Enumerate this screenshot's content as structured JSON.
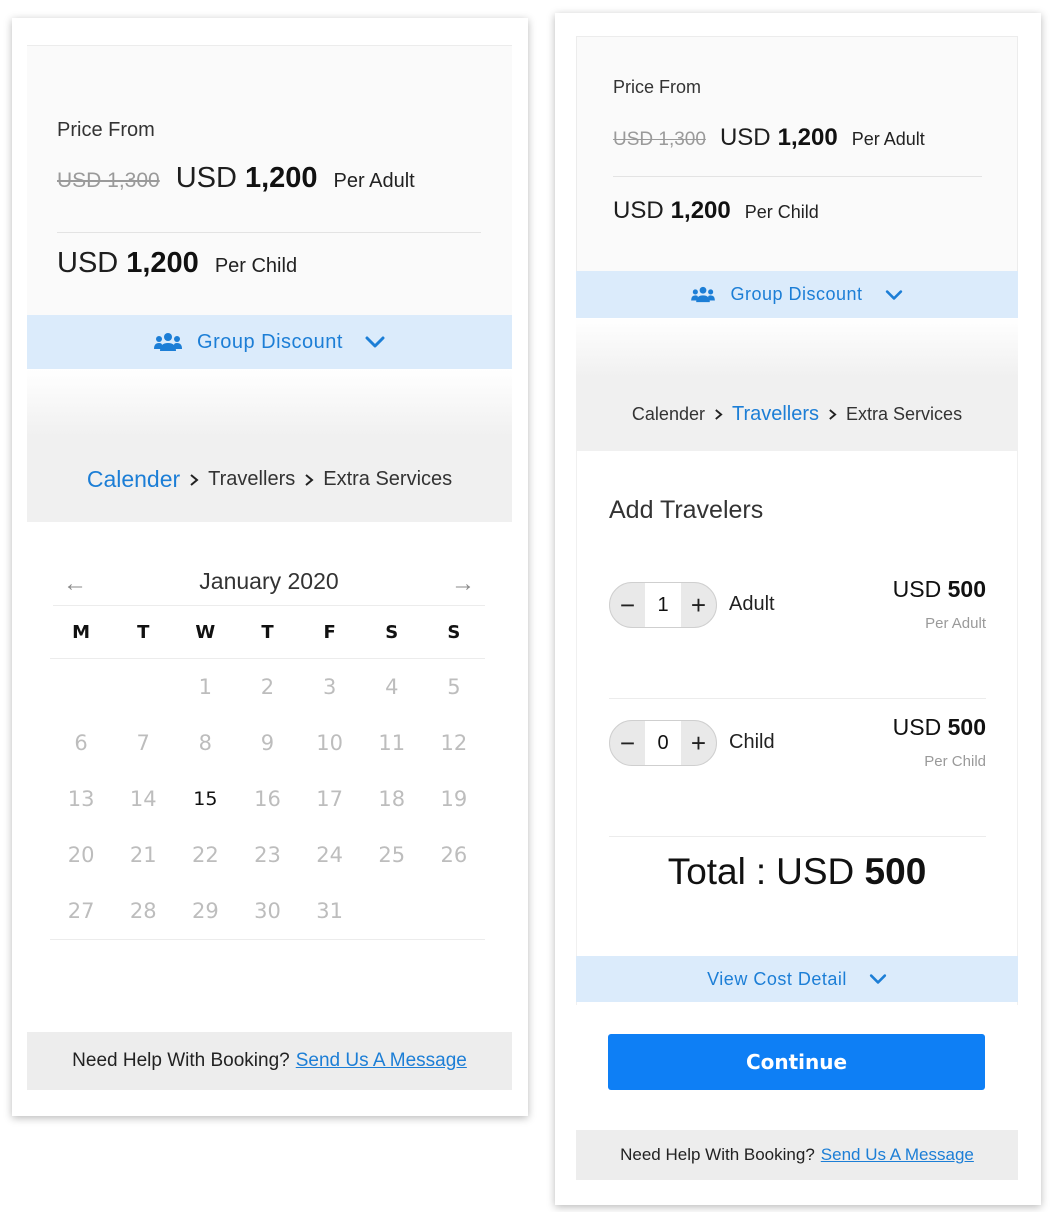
{
  "colors": {
    "accent": "#1c7ed6",
    "primary_button": "#0e7ff5",
    "discount_bg": "#dbebfb",
    "muted": "#9a9a9a"
  },
  "screen1": {
    "price": {
      "label": "Price From",
      "adult": {
        "old": "USD 1,300",
        "currency": "USD",
        "amount": "1,200",
        "per": "Per Adult"
      },
      "child": {
        "currency": "USD",
        "amount": "1,200",
        "per": "Per Child"
      }
    },
    "group_discount": {
      "label": "Group Discount",
      "icon": "users-icon"
    },
    "breadcrumb": {
      "step1": "Calender",
      "step2": "Travellers",
      "step3": "Extra Services",
      "active": "Calender"
    },
    "calendar": {
      "month": "January 2020",
      "prev": "←",
      "next": "→",
      "weekdays": [
        "M",
        "T",
        "W",
        "T",
        "F",
        "S",
        "S"
      ],
      "leading_blanks": 2,
      "days": [
        "1",
        "2",
        "3",
        "4",
        "5",
        "6",
        "7",
        "8",
        "9",
        "10",
        "11",
        "12",
        "13",
        "14",
        "15",
        "16",
        "17",
        "18",
        "19",
        "20",
        "21",
        "22",
        "23",
        "24",
        "25",
        "26",
        "27",
        "28",
        "29",
        "30",
        "31"
      ],
      "selected": "15"
    },
    "help": {
      "text": "Need Help With Booking?",
      "link": "Send Us A Message"
    }
  },
  "screen2": {
    "price": {
      "label": "Price From",
      "adult": {
        "old": "USD 1,300",
        "currency": "USD",
        "amount": "1,200",
        "per": "Per Adult"
      },
      "child": {
        "currency": "USD",
        "amount": "1,200",
        "per": "Per Child"
      }
    },
    "group_discount": {
      "label": "Group Discount",
      "icon": "users-icon"
    },
    "breadcrumb": {
      "step1": "Calender",
      "step2": "Travellers",
      "step3": "Extra Services",
      "active": "Travellers"
    },
    "travelers": {
      "title": "Add Travelers",
      "minus": "−",
      "plus": "+",
      "adult": {
        "count": "1",
        "label": "Adult",
        "currency": "USD",
        "price": "500",
        "per": "Per Adult"
      },
      "child": {
        "count": "0",
        "label": "Child",
        "currency": "USD",
        "price": "500",
        "per": "Per Child"
      }
    },
    "total": {
      "label": "Total",
      "colon": ":",
      "currency": "USD",
      "amount": "500"
    },
    "cost_detail": {
      "label": "View Cost Detail"
    },
    "continue": "Continue",
    "help": {
      "text": "Need Help With Booking?",
      "link": "Send Us A Message"
    }
  }
}
